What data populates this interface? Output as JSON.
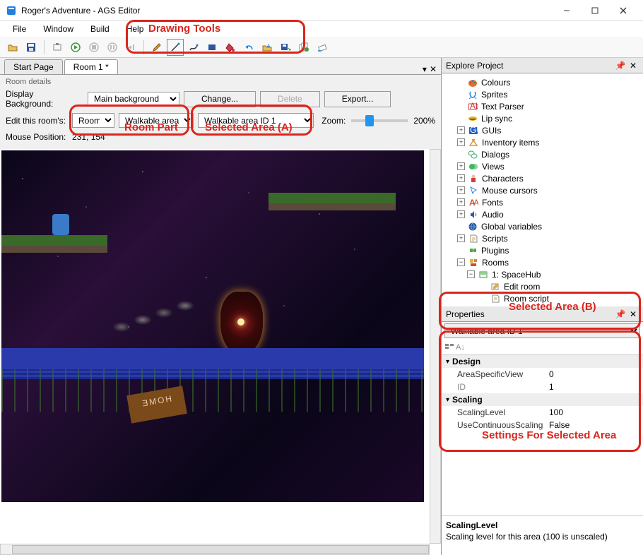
{
  "window": {
    "title": "Roger's Adventure - AGS Editor"
  },
  "menu": {
    "file": "File",
    "window": "Window",
    "build": "Build",
    "help": "Help"
  },
  "tabs": {
    "startPage": "Start Page",
    "room": "Room 1 *"
  },
  "roomDetails": {
    "title": "Room details",
    "displayBgLabel": "Display Background:",
    "displayBgValue": "Main background",
    "changeBtn": "Change...",
    "deleteBtn": "Delete",
    "exportBtn": "Export...",
    "editRoomLabel": "Edit this room's:",
    "roomPartSel1": "Room",
    "roomPartSel2": "Walkable areas",
    "selectedArea": "Walkable area ID 1",
    "zoomLabel": "Zoom:",
    "zoomValue": "200%",
    "mousePosLabel": "Mouse Position:",
    "mousePosValue": "231, 154"
  },
  "canvas": {
    "signText": "HOME"
  },
  "explore": {
    "title": "Explore Project",
    "items": {
      "colours": "Colours",
      "sprites": "Sprites",
      "textparser": "Text Parser",
      "lipsync": "Lip sync",
      "guis": "GUIs",
      "inventory": "Inventory items",
      "dialogs": "Dialogs",
      "views": "Views",
      "characters": "Characters",
      "mousecursors": "Mouse cursors",
      "fonts": "Fonts",
      "audio": "Audio",
      "globals": "Global variables",
      "scripts": "Scripts",
      "plugins": "Plugins",
      "rooms": "Rooms",
      "room1": "1: SpaceHub",
      "editroom": "Edit room",
      "roomscript": "Room script"
    }
  },
  "colors": {
    "palette": "#e07030",
    "sprites": "#2080e0",
    "abc": "#c83838",
    "lips": "#e0b020",
    "gui": "#2060c8",
    "inv": "#d09840",
    "dlg": "#30a860",
    "view": "#40b860",
    "char": "#d83848",
    "cursor": "#2888d8",
    "font": "#c85030",
    "audio": "#2860a8",
    "globe": "#2858a0",
    "script": "#d8b030",
    "plugin": "#50a850",
    "folder": "#e0b040"
  },
  "properties": {
    "title": "Properties",
    "selector": "Walkable area ID 1",
    "groups": {
      "design": "Design",
      "scaling": "Scaling"
    },
    "rows": {
      "areaView": {
        "name": "AreaSpecificView",
        "val": "0"
      },
      "id": {
        "name": "ID",
        "val": "1"
      },
      "scaleLevel": {
        "name": "ScalingLevel",
        "val": "100"
      },
      "useCont": {
        "name": "UseContinuousScaling",
        "val": "False"
      }
    },
    "desc": {
      "title": "ScalingLevel",
      "body": "Scaling level for this area (100 is unscaled)"
    }
  },
  "annotations": {
    "drawingTools": "Drawing Tools",
    "roomPart": "Room Part",
    "selectedAreaA": "Selected Area (A)",
    "selectedAreaB": "Selected Area (B)",
    "settings": "Settings For Selected Area"
  }
}
